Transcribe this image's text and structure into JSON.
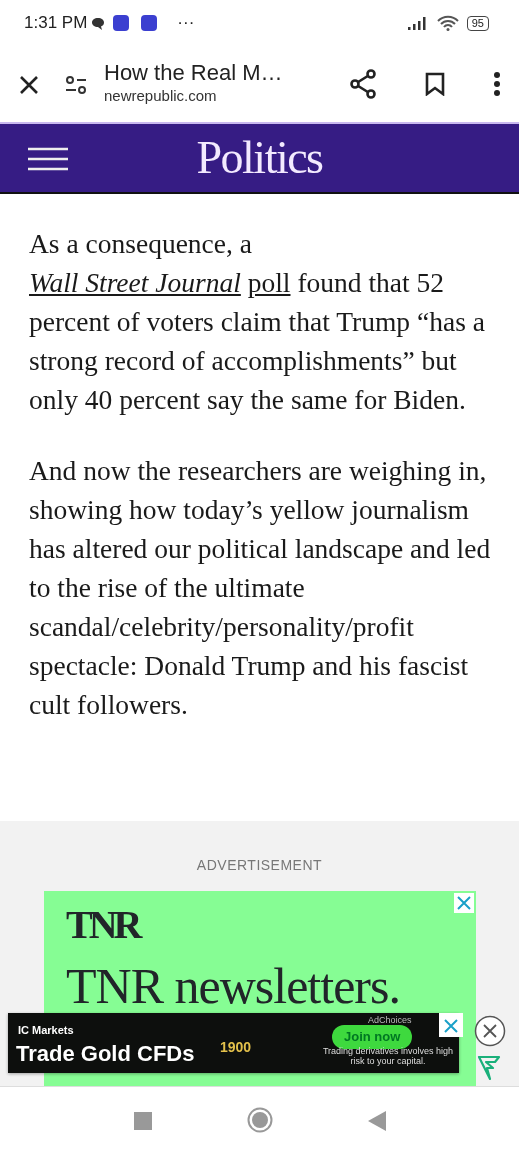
{
  "status_bar": {
    "time": "1:31 PM",
    "notification_more": "···",
    "battery": "95"
  },
  "browser_bar": {
    "title": "How the Real M…",
    "url": "newrepublic.com"
  },
  "site_header": {
    "section": "Politics"
  },
  "article": {
    "paragraphs": [
      [
        {
          "kind": "text",
          "text": "As a consequence, a "
        },
        {
          "kind": "link",
          "text": "*Wall Street Journal*"
        },
        {
          "kind": "link",
          "text": "poll"
        },
        {
          "kind": "text",
          "text": " found that 52 percent of voters claim that Trump “has a strong record of accomplishments” but only 40 percent say the same for Biden."
        }
      ],
      [
        {
          "kind": "text",
          "text": "And now the researchers are weighing in, showing how today’s yellow journalism has altered our political landscape and led to the rise of the ultimate scandal/celebrity/personality/profit spectacle: Donald Trump and his fascist cult followers."
        }
      ]
    ]
  },
  "advertisement": {
    "label": "ADVERTISEMENT",
    "logo": "TNR",
    "headline": "TNR newsletters."
  },
  "sticky_ad": {
    "brand": "IC Markets",
    "headline": "Trade Gold CFDs",
    "price": "1900",
    "button": "Join now",
    "ad_choices": "AdChoices",
    "disclaimer": "Trading derivatives involves high risk to your capital."
  }
}
